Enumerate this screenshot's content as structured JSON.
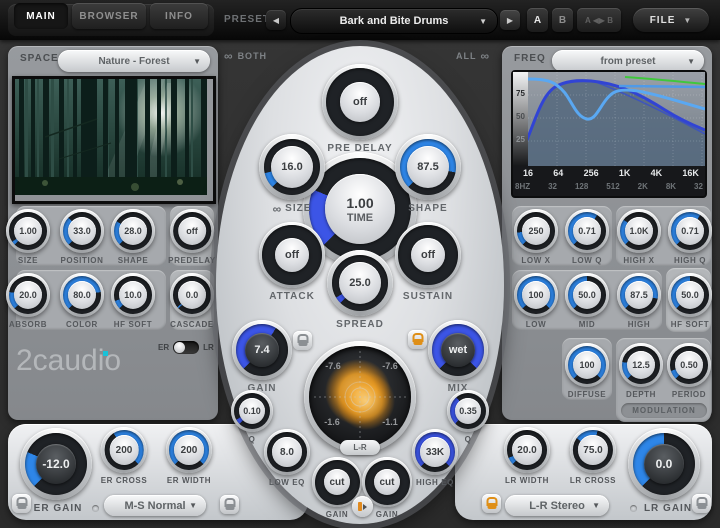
{
  "colors": {
    "accent_blue": "#2e86e8",
    "royal_blue": "#3c55e6",
    "orange": "#df8f17",
    "logo_cyan": "#19c2d8"
  },
  "topbar": {
    "tab_main": "MAIN",
    "tab_browser": "BROWSER",
    "tab_info": "INFO",
    "preset_label": "PRESET",
    "preset_value": "Bark and Bite Drums",
    "prev_arrow": "◀",
    "next_arrow": "▶",
    "caret": "▼",
    "ab_a": "A",
    "ab_b": "B",
    "ab_compare": "A ◀▶ B",
    "file_label": "FILE"
  },
  "left_panel": {
    "space_label": "SPACE",
    "space_value": "Nature - Forest",
    "logo_text": "2caudio",
    "er": "ER",
    "lr": "LR"
  },
  "right_panel": {
    "freq_label": "FREQ",
    "freq_value": "from preset",
    "modulation_label": "MODULATION",
    "graph": {
      "y": [
        "75",
        "50",
        "25"
      ],
      "x_major": [
        "16",
        "64",
        "256",
        "1K",
        "4K",
        "16K"
      ],
      "x_minor": [
        "8HZ",
        "32",
        "128",
        "512",
        "2K",
        "8K",
        "32"
      ]
    }
  },
  "center": {
    "link_both": "BOTH",
    "link_all": "ALL",
    "link_glyph": "∞",
    "lr_button": "L-R",
    "radar": {
      "tl": "-7.6",
      "tr": "-7.6",
      "bl": "-1.6",
      "br": "-1.1"
    }
  },
  "bottom_left": {
    "dropdown": "M-S Normal"
  },
  "bottom_right": {
    "dropdown": "L-R Stereo"
  },
  "knobs": {
    "size_l": {
      "label": "SIZE",
      "value": "1.00",
      "arc": 0.04
    },
    "position": {
      "label": "POSITION",
      "value": "33.0",
      "arc": 0.33
    },
    "shape_l": {
      "label": "SHAPE",
      "value": "28.0",
      "arc": 0.28
    },
    "predelay_l": {
      "label": "PREDELAY",
      "value": "off",
      "arc": 0
    },
    "absorb": {
      "label": "ABSORB",
      "value": "20.0",
      "arc": 0.2
    },
    "color": {
      "label": "COLOR",
      "value": "80.0",
      "arc": 0.8
    },
    "hf_soft_l": {
      "label": "HF SOFT",
      "value": "10.0",
      "arc": 0.1
    },
    "cascade": {
      "label": "CASCADE",
      "value": "0.0",
      "arc": 0.02
    },
    "predelay_c": {
      "label": "PRE DELAY",
      "value": "off",
      "arc": 0
    },
    "size_c": {
      "label": "SIZE",
      "value": "16.0",
      "arc": 0.12
    },
    "shape_c": {
      "label": "SHAPE",
      "value": "87.5",
      "arc": 0.875
    },
    "time": {
      "label": "TIME",
      "value": "1.00",
      "sub": "TIME",
      "arc": 0.25,
      "c": "royal"
    },
    "attack": {
      "label": "ATTACK",
      "value": "off",
      "arc": 0
    },
    "sustain": {
      "label": "SUSTAIN",
      "value": "off",
      "arc": 0
    },
    "spread": {
      "label": "SPREAD",
      "value": "25.0",
      "arc": 0.05,
      "c": "royal"
    },
    "gain": {
      "label": "GAIN",
      "value": "7.4",
      "arc": 0.62,
      "cap": "dark",
      "c": "royal"
    },
    "mix": {
      "label": "MIX",
      "value": "wet",
      "arc": 1,
      "cap": "dark",
      "c": "royal"
    },
    "q_low": {
      "label": "Q",
      "value": "0.10",
      "arc": 0.06,
      "c": "royal"
    },
    "q_high": {
      "label": "Q",
      "value": "0.35",
      "arc": 0.35,
      "c": "royal"
    },
    "low_eq": {
      "label": "LOW EQ",
      "value": "8.0",
      "arc": 0
    },
    "cut_1": {
      "label": "GAIN",
      "value": "cut",
      "arc": 0
    },
    "cut_2": {
      "label": "GAIN",
      "value": "cut",
      "arc": 0
    },
    "high_eq": {
      "label": "HIGH EQ",
      "value": "33K",
      "arc": 1,
      "c": "royal"
    },
    "low_x": {
      "label": "LOW X",
      "value": "250",
      "arc": 0.15
    },
    "low_q": {
      "label": "LOW Q",
      "value": "0.71",
      "arc": 0.62
    },
    "high_x": {
      "label": "HIGH X",
      "value": "1.0K",
      "arc": 0.3
    },
    "high_q": {
      "label": "HIGH Q",
      "value": "0.71",
      "arc": 0.62
    },
    "low": {
      "label": "LOW",
      "value": "100",
      "arc": 1
    },
    "mid": {
      "label": "MID",
      "value": "50.0",
      "arc": 0.5
    },
    "high": {
      "label": "HIGH",
      "value": "87.5",
      "arc": 0.875
    },
    "hf_soft_r": {
      "label": "HF SOFT",
      "value": "50.0",
      "arc": 0.5
    },
    "diffuse": {
      "label": "DIFFUSE",
      "value": "100",
      "arc": 1
    },
    "depth": {
      "label": "DEPTH",
      "value": "12.5",
      "arc": 0.2
    },
    "period": {
      "label": "PERIOD",
      "value": "0.50",
      "arc": 0.1
    },
    "er_gain": {
      "label": "ER GAIN",
      "value": "-12.0",
      "arc": 0.25,
      "cap": "dark"
    },
    "er_cross": {
      "label": "ER CROSS",
      "value": "200",
      "a0": 0.38,
      "arc": 1
    },
    "er_width": {
      "label": "ER WIDTH",
      "value": "200",
      "arc": 1
    },
    "lr_width": {
      "label": "LR WIDTH",
      "value": "20.0",
      "arc": 0.08
    },
    "lr_cross": {
      "label": "LR CROSS",
      "value": "75.0",
      "a0": 0.3,
      "arc": 0.55
    },
    "lr_gain": {
      "label": "LR GAIN",
      "value": "0.0",
      "arc": 0.5,
      "cap": "dark"
    }
  }
}
